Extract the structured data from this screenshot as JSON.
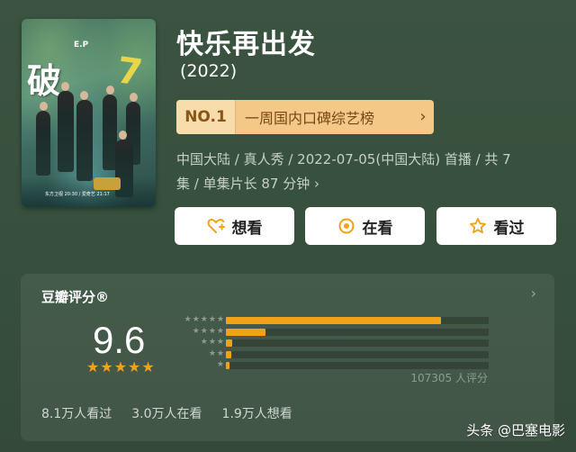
{
  "show": {
    "title": "快乐再出发",
    "year": "(2022)",
    "poster": {
      "title_text": "破7",
      "badge_text": "E.P",
      "bottom_text": "东方卫视 20:30 / 爱奇艺 21:17"
    }
  },
  "ranking": {
    "number": "NO.1",
    "label": "一周国内口碑综艺榜",
    "arrow": "›"
  },
  "info": {
    "line1": "中国大陆 / 真人秀 / 2022-07-05(中国大陆) 首播 / 共 7",
    "line2": "集 / 单集片长 87 分钟",
    "chevron": "›"
  },
  "actions": [
    {
      "label": "想看",
      "icon": "heart-plus-icon"
    },
    {
      "label": "在看",
      "icon": "target-circle-icon"
    },
    {
      "label": "看过",
      "icon": "star-outline-icon"
    }
  ],
  "rating": {
    "header": "豆瓣评分®",
    "more": "›",
    "score": "9.6",
    "stars_filled": 5,
    "distribution": [
      {
        "stars": 5,
        "fraction": 0.82
      },
      {
        "stars": 4,
        "fraction": 0.15
      },
      {
        "stars": 3,
        "fraction": 0.025
      },
      {
        "stars": 2,
        "fraction": 0.02
      },
      {
        "stars": 1,
        "fraction": 0.015
      }
    ],
    "votes": "107305 人评分",
    "stats": [
      "8.1万人看过",
      "3.0万人在看",
      "1.9万人想看"
    ]
  },
  "colors": {
    "accent": "#f2a218",
    "background": "#3b5340",
    "rank_bg": "#f4c988"
  },
  "watermark": "头条 @巴塞电影"
}
